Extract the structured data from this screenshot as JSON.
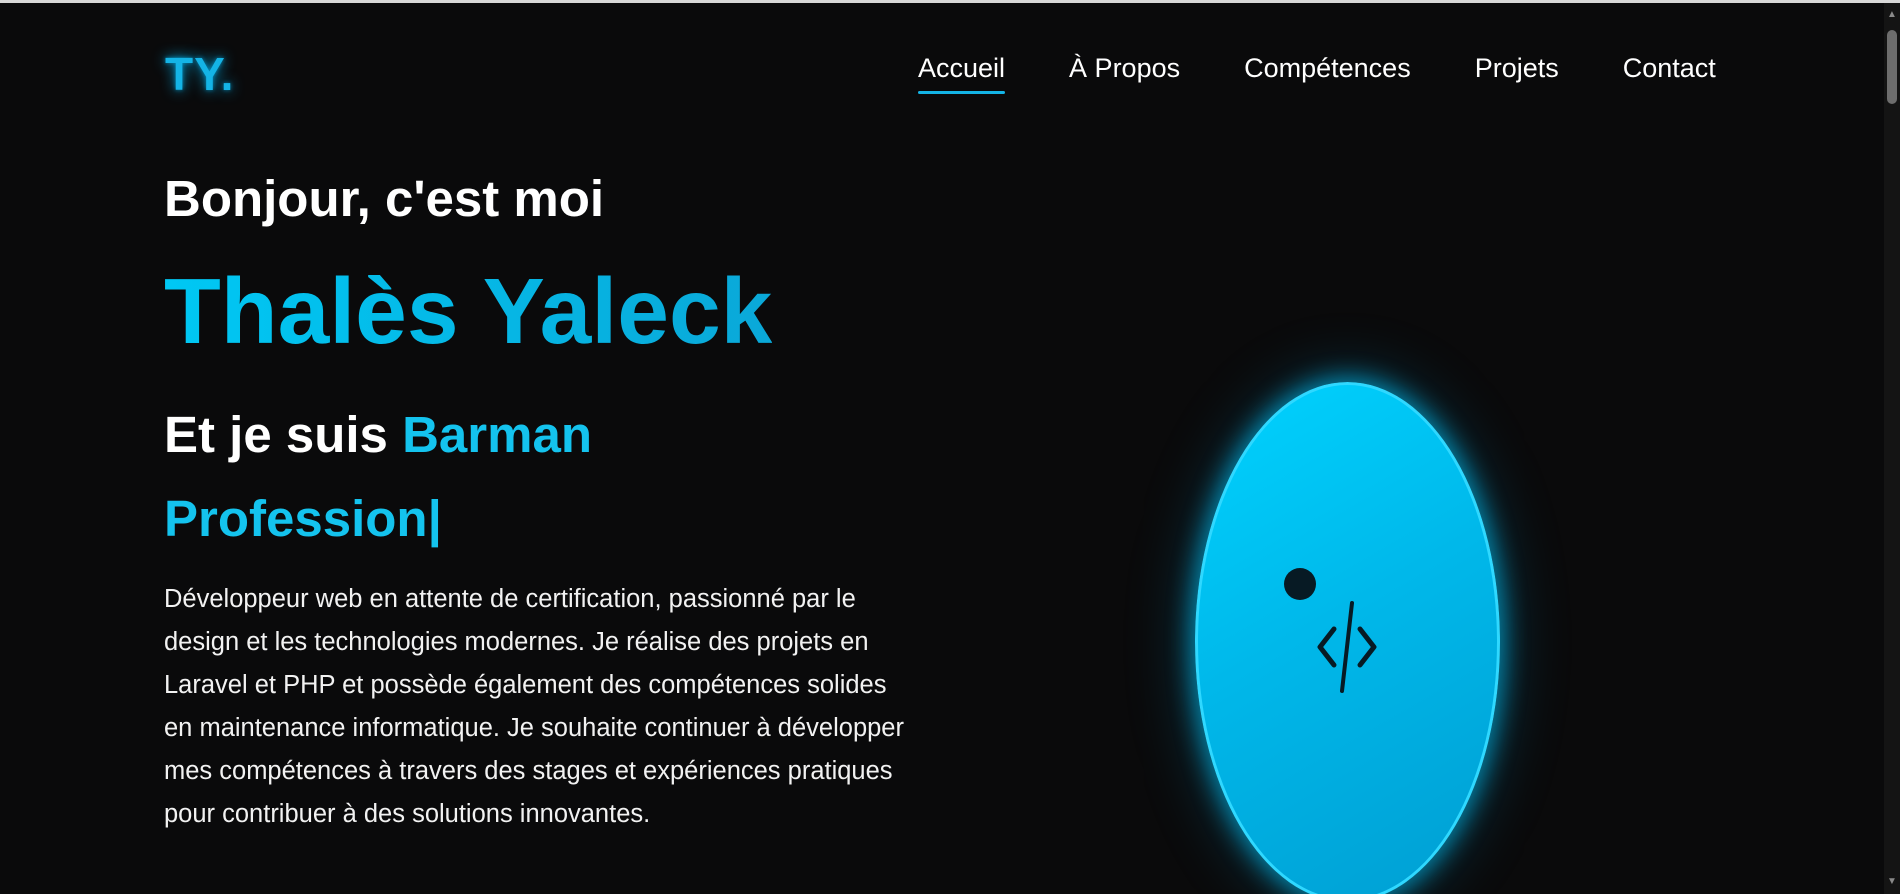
{
  "header": {
    "logo": "TY.",
    "nav": [
      {
        "label": "Accueil",
        "active": true
      },
      {
        "label": "À Propos",
        "active": false
      },
      {
        "label": "Compétences",
        "active": false
      },
      {
        "label": "Projets",
        "active": false
      },
      {
        "label": "Contact",
        "active": false
      }
    ]
  },
  "hero": {
    "greeting": "Bonjour, c'est moi",
    "name": "Thalès Yaleck",
    "role_prefix": "Et je suis",
    "role": "Barman",
    "typing_text": "Profession|",
    "bio": "Développeur web en attente de certification, passionné par le design et les technologies modernes. Je réalise des projets en Laravel et PHP et possède également des compétences solides en maintenance informatique. Je souhaite continuer à développer mes compétences à travers des stages et expériences pratiques pour contribuer à des solutions innovantes."
  },
  "visual": {
    "icon": "code-icon",
    "accent_color": "#00c8f4",
    "background_color": "#0a0a0b"
  }
}
